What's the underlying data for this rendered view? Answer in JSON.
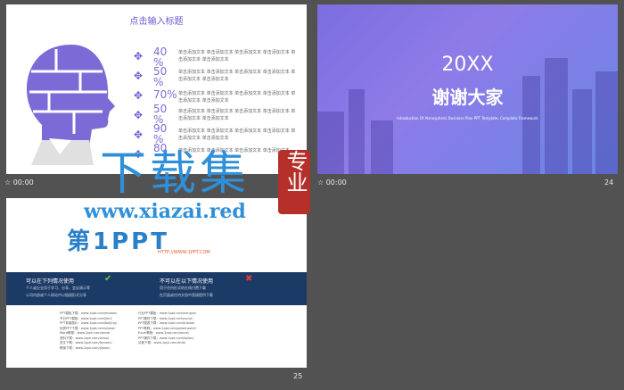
{
  "slide23": {
    "title": "点击输入标题",
    "time": "00:00",
    "rows": [
      {
        "pct": "40",
        "unit": "%",
        "text": "单击添加文本 单击添加文本 单击添加文本 单击添加文本 单击添加文本 单击添加文本"
      },
      {
        "pct": "50",
        "unit": "%",
        "text": "单击添加文本 单击添加文本 单击添加文本 单击添加文本 单击添加文本 单击添加文本"
      },
      {
        "pct": "70%",
        "unit": "",
        "text": "单击添加文本 单击添加文本 单击添加文本 单击添加文本 单击添加文本 单击添加文本"
      },
      {
        "pct": "50",
        "unit": "%",
        "text": "单击添加文本 单击添加文本 单击添加文本 单击添加文本 单击添加文本 单击添加文本"
      },
      {
        "pct": "90",
        "unit": "%",
        "text": "单击添加文本 单击添加文本 单击添加文本 单击添加文本 单击添加文本 单击添加文本"
      },
      {
        "pct": "80",
        "unit": "",
        "text": "单击添加文本 单击添加文本 单击添加文本 单击添加文本"
      }
    ]
  },
  "slide24": {
    "big": "20XX",
    "thanks": "谢谢大家",
    "sub": "Introduction Of Atmospheric Business Plan PPT Template, Complete Framework",
    "time": "00:00",
    "number": "24"
  },
  "slide25": {
    "logo_main": "第1PPT",
    "logo_url": "HTTP://WWW.1PPT.COM",
    "can_title": "可以在下列情况使用",
    "cannot_title": "不可以在以下情况使用",
    "can_lines": [
      "个人或企业用于学习、分享、会议演示等",
      "公司内部或个人网站中以链接形式分享"
    ],
    "cannot_lines": [
      "用于任何形式的在线付费下载",
      "在页面或任何文档中直接提供下载"
    ],
    "links_left": [
      "PPT模板下载：www.1ppt.com/moban/",
      "节日PPT模板：www.1ppt.com/jieri/",
      "PPT背景图片：www.1ppt.com/beijing/",
      "优秀PPT下载：www.1ppt.com/xiazai/",
      "Word教程：www.1ppt.com/word/",
      "资料下载：www.1ppt.com/ziliao/",
      "范文下载：www.1ppt.com/fanwen/",
      "教案下载：www.1ppt.com/jiaoan/"
    ],
    "links_right": [
      "行业PPT模板：www.1ppt.com/hangye/",
      "PPT素材下载：www.1ppt.com/sucai/",
      "PPT图表下载：www.1ppt.com/tubiao/",
      "PPT教程：www.1ppt.com/powerpoint/",
      "Excel教程：www.1ppt.com/excel/",
      "PPT课件下载：www.1ppt.com/kejian/",
      "试卷下载：www.1ppt.com/shiti/"
    ],
    "number": "25"
  },
  "watermark": {
    "main": "下载集",
    "url": "www.xiazai.red",
    "seal": "专业"
  },
  "colors": {
    "accent": "#6b5bd0",
    "blue": "#2f8fd8",
    "seal": "#b5302a"
  }
}
